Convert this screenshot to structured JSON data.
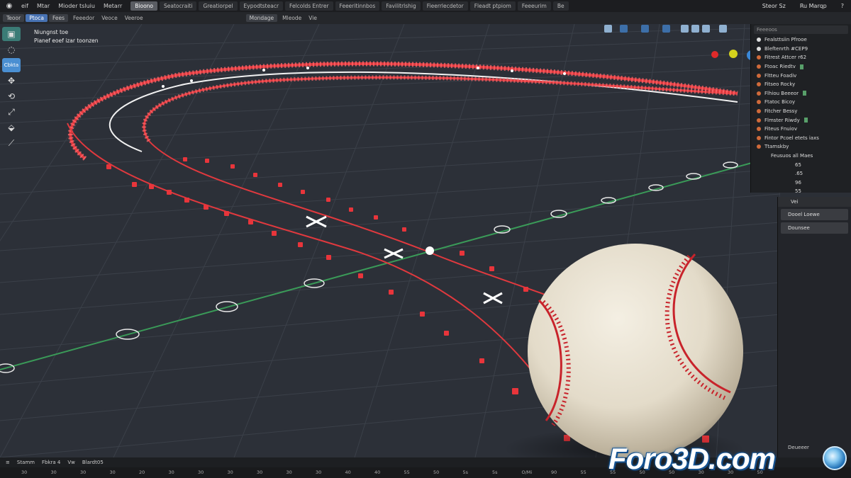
{
  "menubar": {
    "items": [
      "eif",
      "Mtar",
      "Mioder tsluiu",
      "Metarr"
    ],
    "workspaces": [
      "Bioono",
      "Seatocraiti",
      "Greatiorpel",
      "Eypodtsteacr",
      "Felcolds Entrer",
      "Feeeritinnbos",
      "Favilitrlshig",
      "Fieerrlecdetor",
      "Fleadt ptpiom",
      "Feeeurim",
      "Be"
    ],
    "right": [
      "Steor Sz",
      "Ru Marqp",
      "?"
    ]
  },
  "header": {
    "mode_buttons": [
      "Teoor",
      "Ptoca",
      "Fees",
      "Feeedor",
      "Veoce",
      "Veeroe"
    ],
    "center_buttons": [
      "Mondage",
      "Mleode",
      "Vie"
    ]
  },
  "toolbar": {
    "active_label": "Cbkta",
    "icons": [
      "cursor-icon",
      "move-icon",
      "rotate-icon",
      "scale-icon",
      "transform-icon",
      "measure-icon"
    ]
  },
  "overlay": {
    "line1": "Niungnst toe",
    "line2": "Pianef eoef izar toonzen"
  },
  "outliner": {
    "search": "Feeeoos",
    "rows": [
      {
        "label": "Fealsttsiin Pfrooe",
        "dot": "white"
      },
      {
        "label": "Bleftenrth #CEP9",
        "dot": "white"
      },
      {
        "label": "Fitrest Attcer r62",
        "dot": "orange"
      },
      {
        "label": "Ftoac Riedtv",
        "dot": "orange"
      },
      {
        "label": "Fltteu Foadiv",
        "dot": "orange"
      },
      {
        "label": "Fitseo Rocky",
        "dot": "orange"
      },
      {
        "label": "Flhiou Beeeor",
        "dot": "orange"
      },
      {
        "label": "Ftatoc Bicoy",
        "dot": "orange"
      },
      {
        "label": "Fitcher Bessy",
        "dot": "orange"
      },
      {
        "label": "Flmster Riwdy",
        "dot": "orange"
      },
      {
        "label": "Fiteus Fnuiov",
        "dot": "orange"
      },
      {
        "label": "Fintor Pcoel etets iaxs",
        "dot": "orange"
      },
      {
        "label": "Ttamskby",
        "dot": "orange"
      },
      {
        "label": "Feusuos all Maes",
        "dot": "none"
      },
      {
        "label": "65",
        "dot": "none"
      },
      {
        "label": ".65",
        "dot": "none"
      },
      {
        "label": "96",
        "dot": "none"
      },
      {
        "label": "55",
        "dot": "none"
      },
      {
        "label": "93",
        "dot": "none"
      }
    ]
  },
  "properties": {
    "tab": "Vei",
    "fields": [
      "Dooel Loewe",
      "Dounsee"
    ],
    "footer": "Deueeer"
  },
  "timeline": {
    "controls": [
      "Stamm",
      "Fbkra 4",
      "Vw",
      "Blardt05"
    ],
    "ticks": [
      "30",
      "30",
      "30",
      "30",
      "20",
      "30",
      "30",
      "30",
      "30",
      "30",
      "30",
      "40",
      "40",
      "55",
      "50",
      "5s",
      "5s",
      "O/Mi",
      "90",
      "55",
      "55",
      "50",
      "50",
      "30",
      "30",
      "50"
    ]
  },
  "watermark": {
    "text": "Foro3D.com"
  },
  "colors": {
    "curve_red": "#e0393e",
    "ground_line_green": "#3a9a58",
    "accent_blue": "#4a8fd2",
    "viewport_bg": "#2b2f36"
  }
}
